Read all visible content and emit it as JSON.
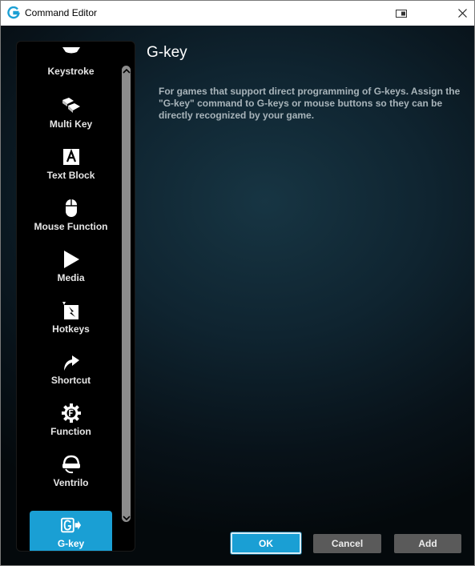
{
  "window": {
    "title": "Command Editor"
  },
  "sidebar": {
    "items": [
      {
        "label": "Keystroke",
        "icon": "keystroke-icon",
        "active": false
      },
      {
        "label": "Multi Key",
        "icon": "multi-key-icon",
        "active": false
      },
      {
        "label": "Text Block",
        "icon": "text-block-icon",
        "active": false
      },
      {
        "label": "Mouse Function",
        "icon": "mouse-icon",
        "active": false
      },
      {
        "label": "Media",
        "icon": "play-icon",
        "active": false
      },
      {
        "label": "Hotkeys",
        "icon": "hotkeys-icon",
        "active": false
      },
      {
        "label": "Shortcut",
        "icon": "shortcut-arrow-icon",
        "active": false
      },
      {
        "label": "Function",
        "icon": "function-gear-icon",
        "active": false
      },
      {
        "label": "Ventrilo",
        "icon": "headset-icon",
        "active": false
      },
      {
        "label": "G-key",
        "icon": "g-key-icon",
        "active": true
      }
    ]
  },
  "panel": {
    "title": "G-key",
    "description": "For games that support direct programming of G-keys.  Assign the \"G-key\" command to G-keys or mouse buttons so they can be directly recognized by your game."
  },
  "buttons": {
    "ok": "OK",
    "cancel": "Cancel",
    "add": "Add"
  },
  "colors": {
    "accent": "#1a9fd4",
    "button_gray": "#5a5a5a",
    "description_text": "#a8b4ba"
  }
}
